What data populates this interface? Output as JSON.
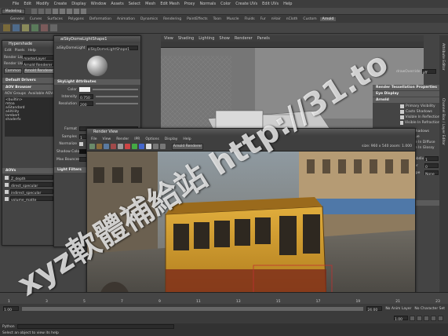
{
  "menubar": [
    "File",
    "Edit",
    "Modify",
    "Create",
    "Display",
    "Window",
    "Assets",
    "Select",
    "Mesh",
    "Edit Mesh",
    "Proxy",
    "Normals",
    "Color",
    "Create UVs",
    "Edit UVs",
    "Help"
  ],
  "mode_select": "Modeling",
  "shelf_tabs": [
    "General",
    "Curves",
    "Surfaces",
    "Polygons",
    "Deformation",
    "Animation",
    "Dynamics",
    "Rendering",
    "PaintEffects",
    "Toon",
    "Muscle",
    "Fluids",
    "Fur",
    "nHair",
    "nCloth",
    "Custom",
    "Arnold"
  ],
  "shelf_active": "Arnold",
  "viewport_menu": [
    "View",
    "Shading",
    "Lighting",
    "Show",
    "Renderer",
    "Panels"
  ],
  "hypershade": {
    "title": "Hypershade",
    "menu": [
      "Edit",
      "Pixels",
      "Help"
    ],
    "render_layer_label": "Render Layer",
    "render_layer_value": "masterLayer",
    "render_using_label": "Render Using",
    "render_using_value": "Arnold Renderer",
    "tabs": [
      "Common",
      "Arnold Renderer"
    ],
    "sections": [
      "Default Drivers",
      "AOV Browser",
      "AOVs"
    ],
    "aov_list": [
      "Z_depth",
      "direct_specular",
      "indirect_specular",
      "volume_matte"
    ],
    "aov_groups_label": "AOV Groups",
    "aov_available_label": "Available AOVs",
    "builtin": [
      "<builtin>",
      "mtoa",
      "aiStandard",
      "aiUtility",
      "lambert",
      "shaderfx"
    ]
  },
  "light_editor": {
    "title": "aiSkyDomeLightShape1",
    "field_label": "aiSkyDomeLight",
    "field_value": "aiSkyDomeLightShape1",
    "section": "SkyLight Attributes",
    "attrs": [
      {
        "label": "Color",
        "value": ""
      },
      {
        "label": "Intensity",
        "value": "0.750"
      },
      {
        "label": "Resolution",
        "value": "200"
      }
    ],
    "format_label": "Format",
    "samples_label": "Samples",
    "samples_value": "1",
    "normalize_label": "Normalize",
    "shadow_color_label": "Shadow Color",
    "shadow_density_label": "Shadow Density",
    "bounce_label": "Max Bounces",
    "light_filters": "Light Filters"
  },
  "render_view": {
    "title": "Render View",
    "menu": [
      "File",
      "View",
      "Render",
      "IPR",
      "Options",
      "Display",
      "Help"
    ],
    "renderer_label": "Arnold Renderer",
    "zoom_label": "1:1",
    "resolution_label": "size: 960 x 540  zoom: 1.000",
    "status": "Frame: 1   Render Time: 10:32"
  },
  "attr_editor": {
    "header": "Render Tessellation Properties",
    "sections": [
      "Eye Display",
      "Arnold"
    ],
    "checkboxes": [
      {
        "label": "Primary Visibility",
        "checked": true
      },
      {
        "label": "Casts Shadows",
        "checked": true
      },
      {
        "label": "Visible In Reflections",
        "checked": true
      },
      {
        "label": "Visible In Refractions",
        "checked": true
      },
      {
        "label": "Self Shadows",
        "checked": true
      },
      {
        "label": "Opaque",
        "checked": true
      },
      {
        "label": "Visible In Diffuse",
        "checked": true
      },
      {
        "label": "Visible In Glossy",
        "checked": true
      }
    ],
    "fields": [
      {
        "label": "Subdiv",
        "value": "1"
      },
      {
        "label": "Iter",
        "value": "0"
      },
      {
        "label": "Type",
        "value": "None"
      }
    ],
    "shader_title": "surfaceShape",
    "side_tabs": [
      "Attribute Editor",
      "Channel Box / Layer Editor"
    ],
    "display_label": "drawOverride",
    "display_value": "off"
  },
  "timeline": {
    "ticks": [
      "1",
      "2",
      "3",
      "4",
      "5",
      "6",
      "7",
      "8",
      "9",
      "10",
      "11",
      "12",
      "13",
      "14",
      "15",
      "16",
      "17",
      "18",
      "19",
      "20",
      "21",
      "22",
      "23",
      "24"
    ],
    "start": "1.00",
    "end": "24.00",
    "current": "1.00",
    "anim_layer": "No Anim Layer",
    "char_set": "No Character Set"
  },
  "helpline": "Python",
  "helpline2": "Select an object to view its help",
  "watermark_1": "xyz軟體補給站 http://31.to",
  "colors": {
    "ui_bg": "#444444",
    "accent_blue": "#5285a6",
    "tram_yellow": "#d19a2a",
    "tram_red": "#8e2e1e",
    "sky": "#a9b8c2"
  }
}
